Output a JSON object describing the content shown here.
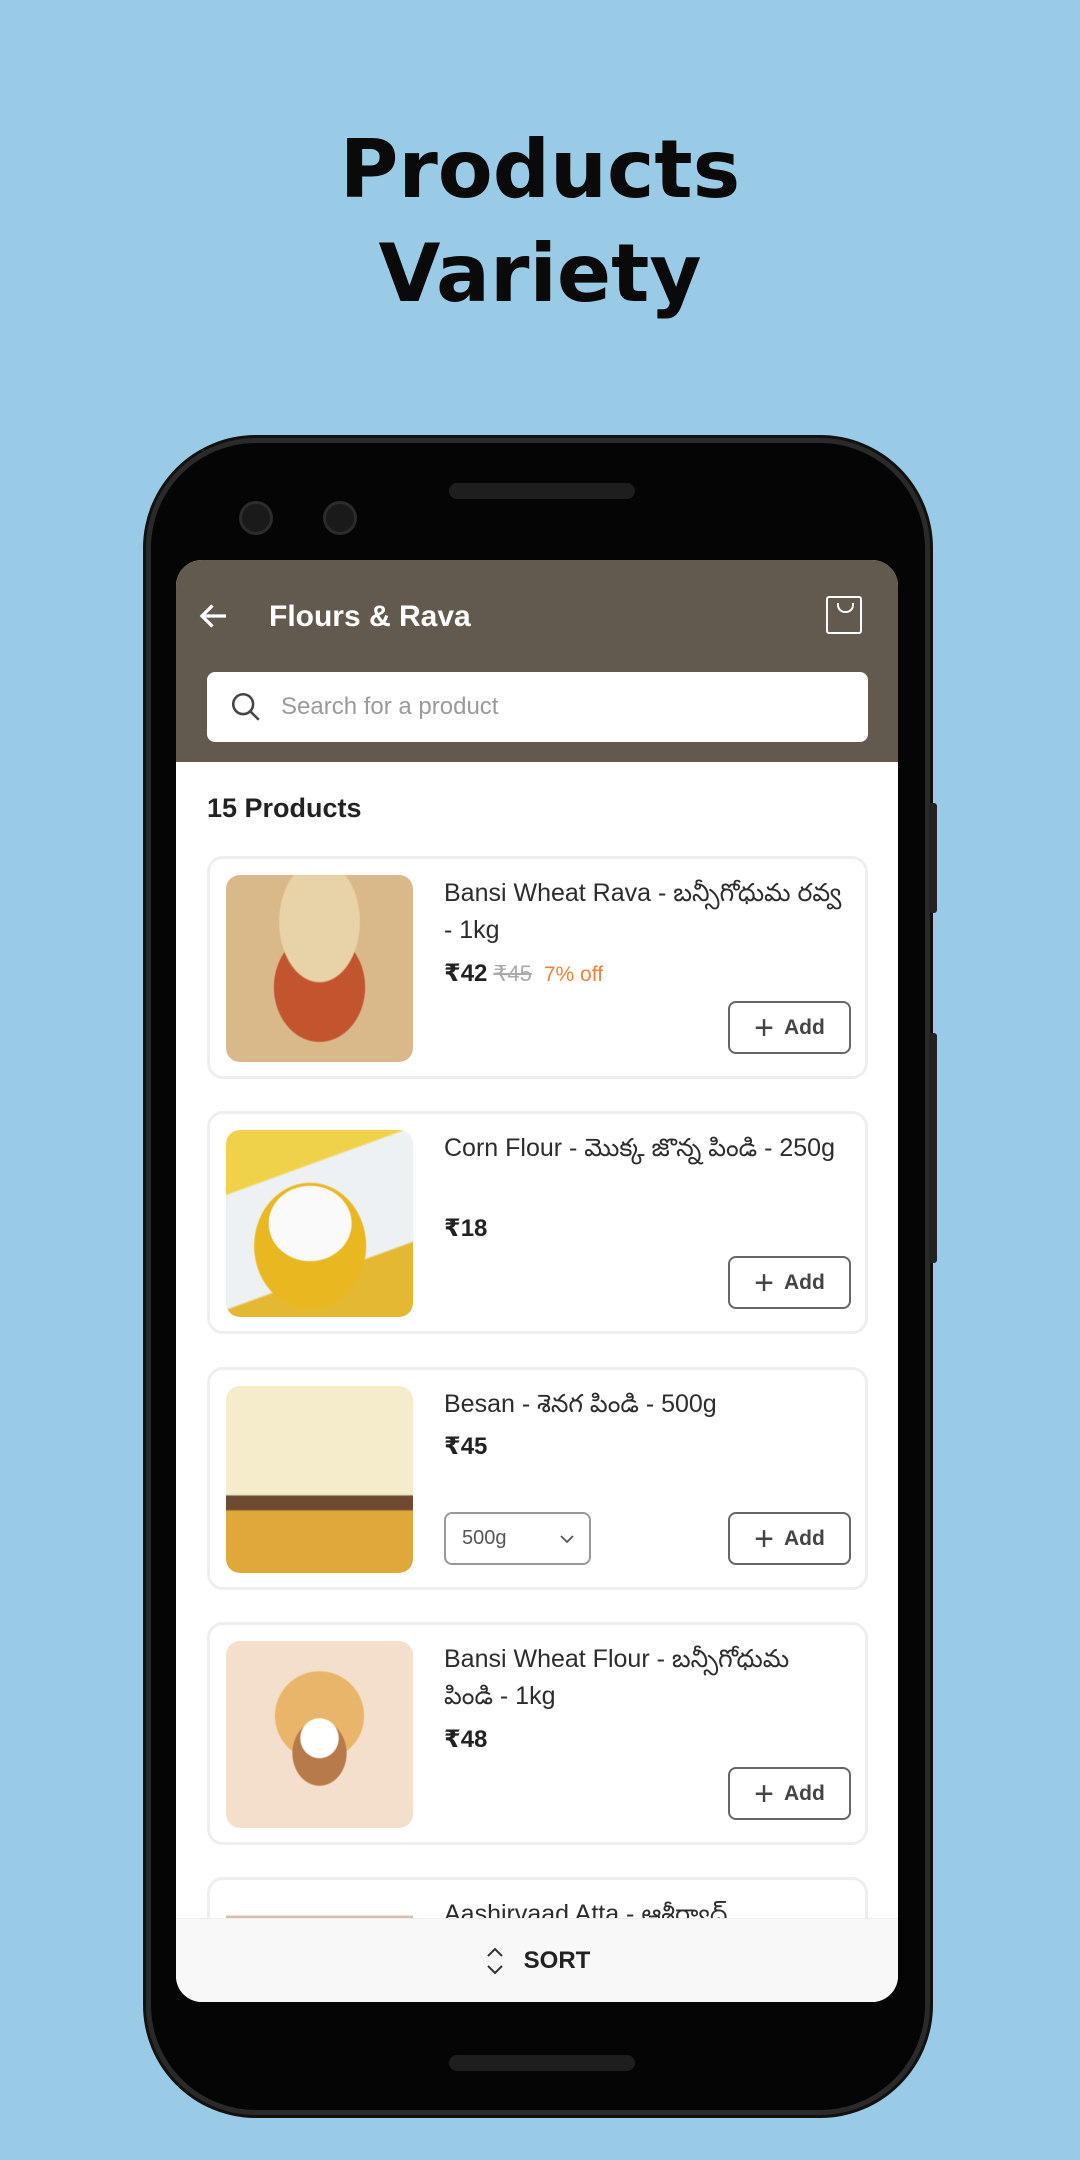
{
  "promo": {
    "line1": "Products",
    "line2": "Variety"
  },
  "header": {
    "title": "Flours & Rava",
    "back_icon": "arrow-left-icon",
    "cart_icon": "shopping-bag-icon"
  },
  "search": {
    "placeholder": "Search for a product",
    "value": ""
  },
  "product_count": "15 Products",
  "colors": {
    "header": "#635A4F",
    "background": "#9ACBE6",
    "discount": "#F0813C"
  },
  "products": [
    {
      "name": "Bansi Wheat Rava - బన్సీగోధుమ రవ్వ - 1kg",
      "price": "₹42",
      "mrp": "₹45",
      "discount": "7% off",
      "add_label": "Add"
    },
    {
      "name": "Corn Flour - మొక్క జొన్న పిండి - 250g",
      "price": "₹18",
      "add_label": "Add"
    },
    {
      "name": "Besan - శెనగ పిండి - 500g",
      "price": "₹45",
      "variant": "500g",
      "add_label": "Add"
    },
    {
      "name": "Bansi Wheat Flour - బన్సీగోధుమ పిండి - 1kg",
      "price": "₹48",
      "add_label": "Add"
    },
    {
      "name": "Aashirvaad Atta - ఆశీర్వాద్"
    }
  ],
  "sort": {
    "label": "SORT",
    "icon": "sort-icon"
  }
}
